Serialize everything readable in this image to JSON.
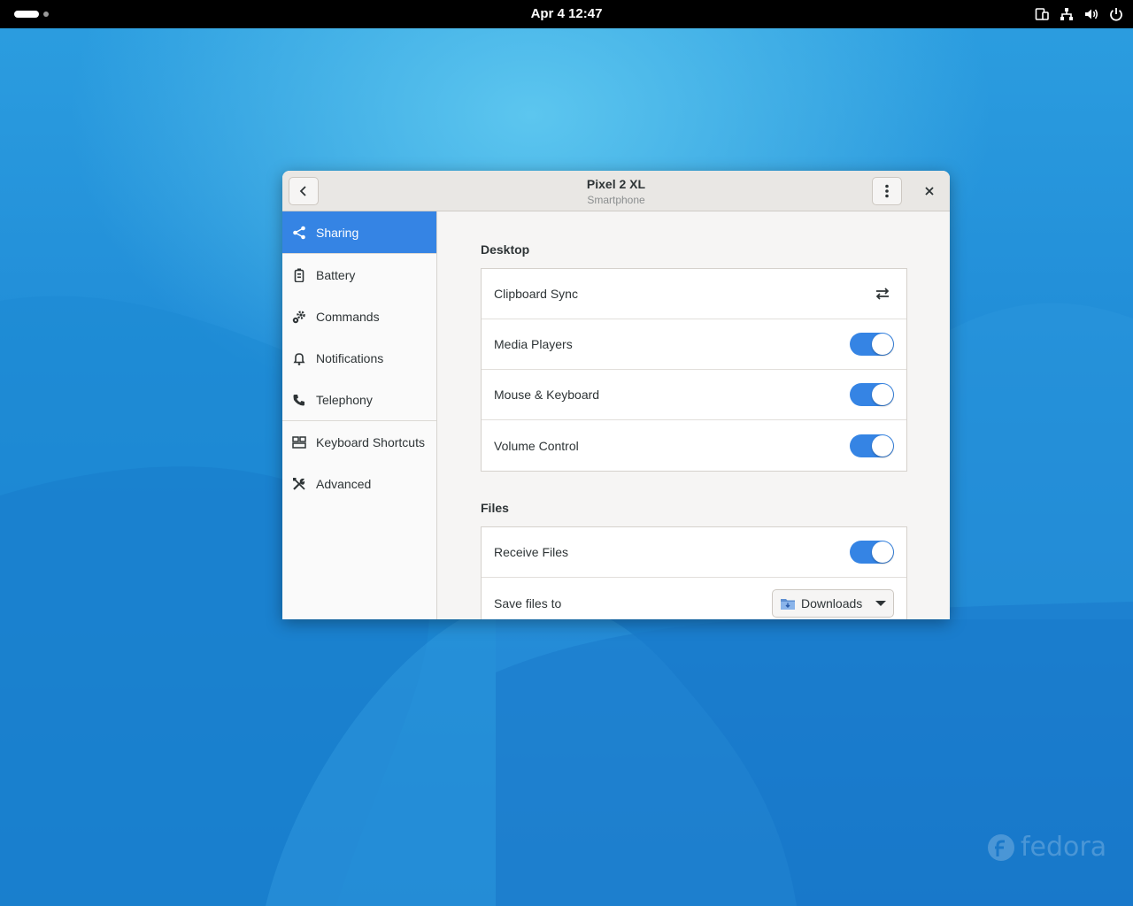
{
  "topbar": {
    "clock": "Apr 4  12:47"
  },
  "wallpaper": {
    "brand": "fedora"
  },
  "window": {
    "title": "Pixel 2 XL",
    "subtitle": "Smartphone",
    "accent": "#3584e4"
  },
  "sidebar": {
    "items": [
      {
        "label": "Sharing",
        "icon": "share-icon",
        "active": true
      },
      {
        "label": "Battery",
        "icon": "battery-icon"
      },
      {
        "label": "Commands",
        "icon": "gears-icon"
      },
      {
        "label": "Notifications",
        "icon": "bell-icon"
      },
      {
        "label": "Telephony",
        "icon": "phone-icon"
      },
      {
        "label": "Keyboard Shortcuts",
        "icon": "keyboard-shortcuts-icon"
      },
      {
        "label": "Advanced",
        "icon": "tools-icon"
      }
    ]
  },
  "desktop": {
    "title": "Desktop",
    "rows": [
      {
        "label": "Clipboard Sync",
        "control": "sync-arrows-icon"
      },
      {
        "label": "Media Players",
        "control": "switch",
        "on": true
      },
      {
        "label": "Mouse & Keyboard",
        "control": "switch",
        "on": true
      },
      {
        "label": "Volume Control",
        "control": "switch",
        "on": true
      }
    ]
  },
  "files": {
    "title": "Files",
    "rows": [
      {
        "label": "Receive Files",
        "control": "switch",
        "on": true
      },
      {
        "label": "Save files to",
        "control": "combo",
        "value": "Downloads"
      }
    ]
  }
}
